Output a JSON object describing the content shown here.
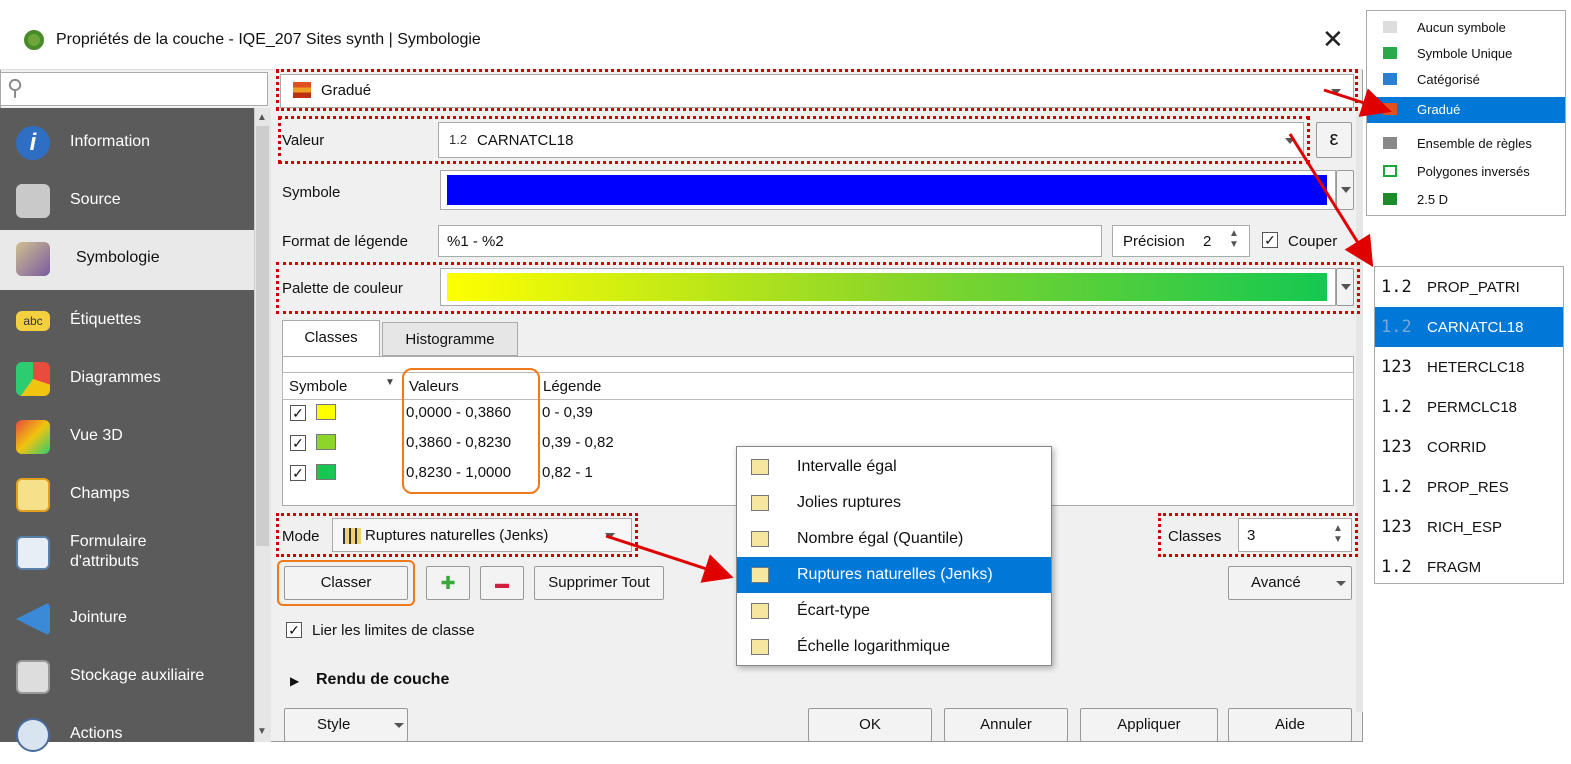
{
  "window": {
    "title": "Propriétés de la couche - IQE_207 Sites synth | Symbologie",
    "close": "✕"
  },
  "sidebar": {
    "items": [
      {
        "label": "Information",
        "icon": "info-icon"
      },
      {
        "label": "Source",
        "icon": "source-icon"
      },
      {
        "label": "Symbologie",
        "icon": "symbology-brush-icon"
      },
      {
        "label": "Étiquettes",
        "icon": "labels-abc-icon"
      },
      {
        "label": "Diagrammes",
        "icon": "diagrams-icon"
      },
      {
        "label": "Vue 3D",
        "icon": "cube-3d-icon"
      },
      {
        "label": "Champs",
        "icon": "fields-icon"
      },
      {
        "label": "Formulaire",
        "label2": "d'attributs",
        "icon": "form-icon"
      },
      {
        "label": "Jointure",
        "icon": "join-icon"
      },
      {
        "label": "Stockage auxiliaire",
        "icon": "storage-icon"
      },
      {
        "label": "Actions",
        "icon": "actions-icon"
      }
    ]
  },
  "renderer": {
    "value": "Gradué"
  },
  "valeur": {
    "label": "Valeur",
    "type": "1.2",
    "field": "CARNATCL18",
    "expr": "ε"
  },
  "symbole": {
    "label": "Symbole",
    "color": "#0000ff"
  },
  "legend_format": {
    "label": "Format de légende",
    "value": "%1 - %2",
    "precision_label": "Précision",
    "precision": "2",
    "trim_label": "Couper",
    "trim_check": "✓"
  },
  "palette": {
    "label": "Palette de couleur"
  },
  "tabs": {
    "classes": "Classes",
    "histogram": "Histogramme"
  },
  "table": {
    "headers": {
      "symbol": "Symbole",
      "values": "Valeurs",
      "legend": "Légende"
    },
    "rows": [
      {
        "check": "✓",
        "color": "#ffff00",
        "values": "0,0000 - 0,3860",
        "legend": "0 - 0,39"
      },
      {
        "check": "✓",
        "color": "#8cd629",
        "values": "0,3860 - 0,8230",
        "legend": "0,39 - 0,82"
      },
      {
        "check": "✓",
        "color": "#14c850",
        "values": "0,8230 - 1,0000",
        "legend": "0,82 - 1"
      }
    ]
  },
  "mode": {
    "label": "Mode",
    "value": "Ruptures naturelles (Jenks)"
  },
  "classes_count": {
    "label": "Classes",
    "value": "3"
  },
  "buttons": {
    "classer": "Classer",
    "add": "✚",
    "remove": "▬",
    "delete_all": "Supprimer Tout",
    "advanced": "Avancé",
    "style": "Style",
    "ok": "OK",
    "cancel": "Annuler",
    "apply": "Appliquer",
    "help": "Aide"
  },
  "link_limits": {
    "check": "✓",
    "label": "Lier les limites de classe"
  },
  "layer_rendering": {
    "label": "Rendu de couche"
  },
  "mode_popup": [
    {
      "label": "Intervalle égal",
      "icon": "equal-interval-icon"
    },
    {
      "label": "Jolies ruptures",
      "icon": "pretty-breaks-icon"
    },
    {
      "label": "Nombre égal (Quantile)",
      "icon": "quantile-icon"
    },
    {
      "label": "Ruptures naturelles (Jenks)",
      "icon": "jenks-icon"
    },
    {
      "label": "Écart-type",
      "icon": "std-dev-icon"
    },
    {
      "label": "Échelle logarithmique",
      "icon": "log-scale-icon"
    }
  ],
  "renderer_menu": [
    {
      "label": "Aucun symbole",
      "color": "#dddddd"
    },
    {
      "label": "Symbole Unique",
      "color": "#2aa84a"
    },
    {
      "label": "Catégorisé",
      "color": "#2a7fd0"
    },
    {
      "label": "Gradué",
      "color": "#e05020"
    },
    {
      "label": "Ensemble de règles",
      "color": "#888888"
    },
    {
      "label": "Polygones inversés",
      "color": "#1aa83a"
    },
    {
      "label": "2.5 D",
      "color": "#1f8a2a"
    }
  ],
  "field_list": [
    {
      "type": "1.2",
      "name": "PROP_PATRI"
    },
    {
      "type": "1.2",
      "name": "CARNATCL18"
    },
    {
      "type": "123",
      "name": "HETERCLC18"
    },
    {
      "type": "1.2",
      "name": "PERMCLC18"
    },
    {
      "type": "123",
      "name": "CORRID"
    },
    {
      "type": "1.2",
      "name": "PROP_RES"
    },
    {
      "type": "123",
      "name": "RICH_ESP"
    },
    {
      "type": "1.2",
      "name": "FRAGM"
    }
  ]
}
